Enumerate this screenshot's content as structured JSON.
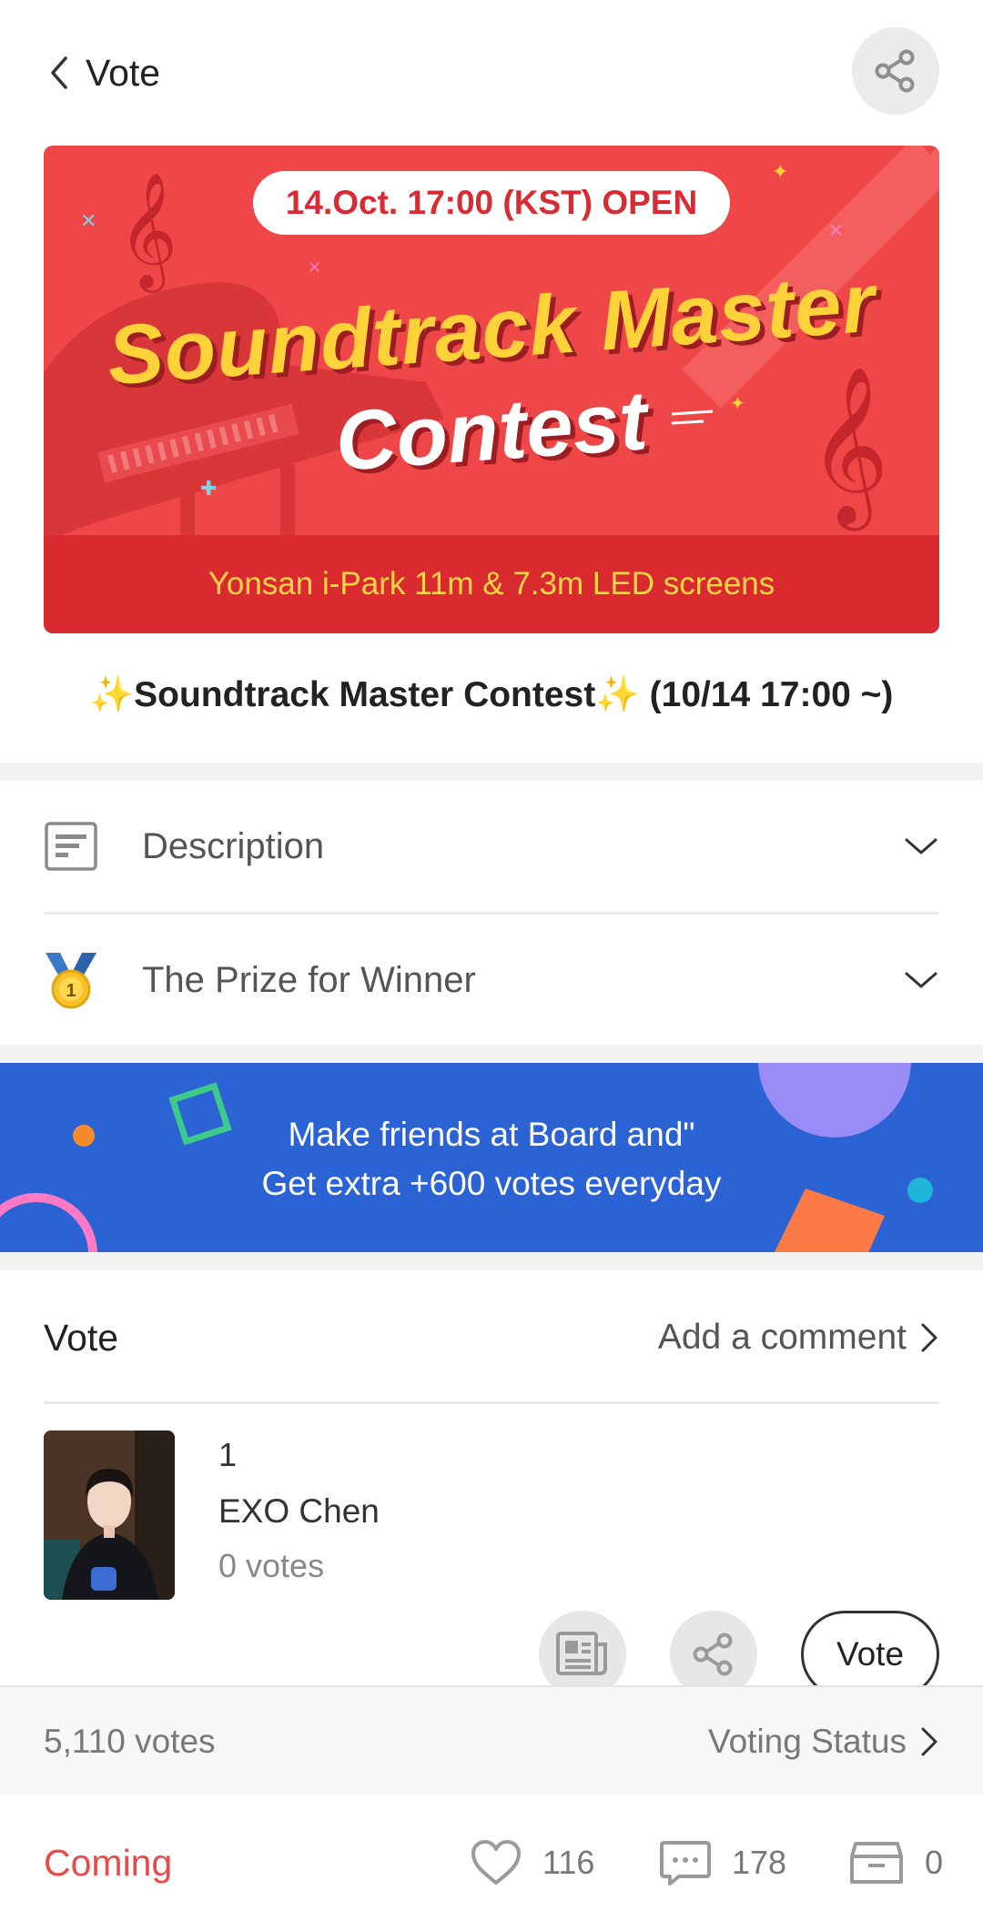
{
  "header": {
    "back_label": "Vote",
    "back_icon": "chevron-left-icon",
    "share_icon": "share-icon"
  },
  "banner": {
    "date_badge": "14.Oct. 17:00 (KST) OPEN",
    "title_line1": "Soundtrack Master",
    "title_line2": "Contest",
    "footer_text": "Yonsan i-Park 11m & 7.3m LED screens"
  },
  "vote_title": {
    "sparkle": "✨",
    "text": "Soundtrack Master Contest",
    "schedule": "(10/14 17:00 ~)"
  },
  "accordion": [
    {
      "label": "Description",
      "icon": "document-icon"
    },
    {
      "label": "The Prize for Winner",
      "icon": "medal-icon"
    }
  ],
  "promo": {
    "line1": "Make friends at Board and\"",
    "line2": "Get extra +600 votes everyday"
  },
  "vote_section": {
    "title": "Vote",
    "comment_link": "Add a comment"
  },
  "candidate": {
    "rank": "1",
    "name": "EXO Chen",
    "votes": "0 votes",
    "vote_button": "Vote"
  },
  "status": {
    "total_votes": "5,110 votes",
    "voting_status_link": "Voting Status"
  },
  "footer": {
    "state": "Coming",
    "likes": "116",
    "comments": "178",
    "boxes": "0"
  },
  "colors": {
    "banner_red": "#ef4747",
    "promo_blue": "#2c63d4",
    "coming_red": "#e94a4a"
  }
}
